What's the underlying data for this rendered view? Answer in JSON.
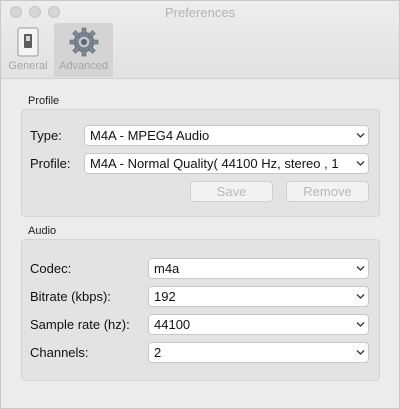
{
  "window": {
    "title": "Preferences"
  },
  "toolbar": {
    "items": [
      {
        "label": "General"
      },
      {
        "label": "Advanced"
      }
    ]
  },
  "profile": {
    "section_label": "Profile",
    "type_label": "Type:",
    "type_value": "M4A - MPEG4 Audio",
    "profile_label": "Profile:",
    "profile_value": "M4A - Normal Quality( 44100 Hz, stereo , 1",
    "save_label": "Save",
    "remove_label": "Remove"
  },
  "audio": {
    "section_label": "Audio",
    "codec_label": "Codec:",
    "codec_value": "m4a",
    "bitrate_label": "Bitrate (kbps):",
    "bitrate_value": "192",
    "samplerate_label": "Sample rate (hz):",
    "samplerate_value": "44100",
    "channels_label": "Channels:",
    "channels_value": "2"
  }
}
